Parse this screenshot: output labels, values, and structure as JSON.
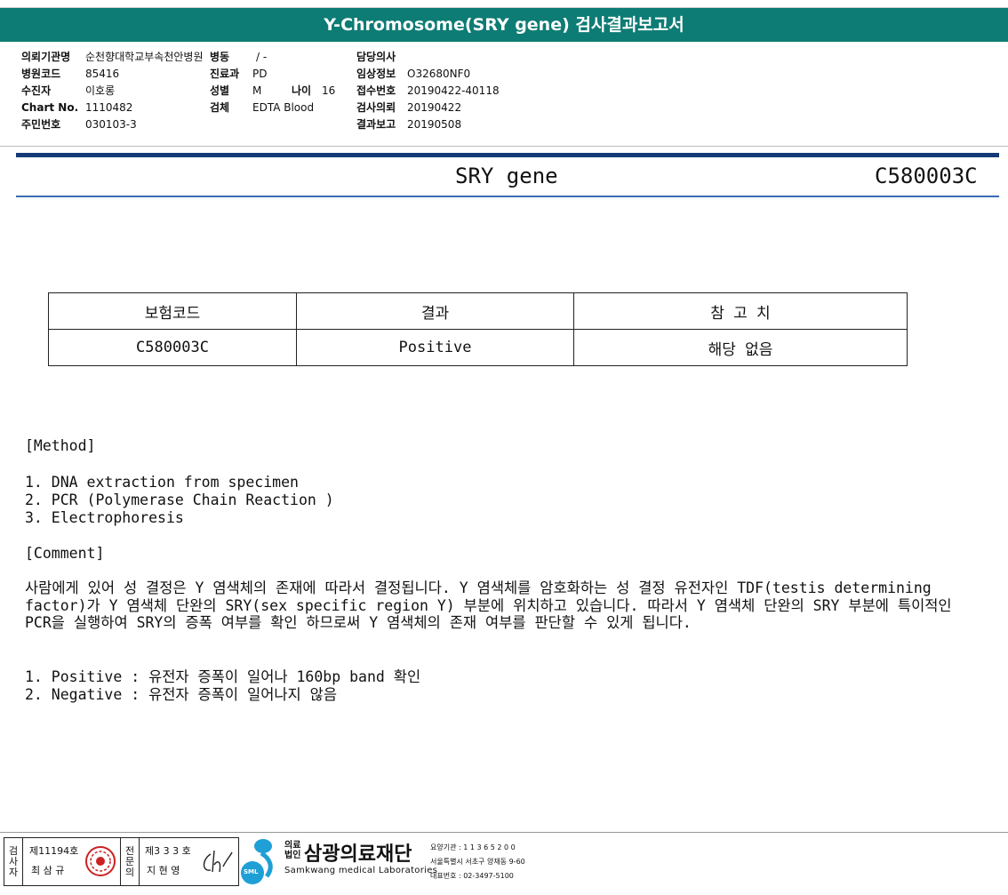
{
  "report": {
    "title": "Y-Chromosome(SRY gene) 검사결과보고서"
  },
  "patient_info": {
    "col1": [
      {
        "label": "의뢰기관명",
        "value": "순천향대학교부속천안병원"
      },
      {
        "label": "병원코드",
        "value": "85416"
      },
      {
        "label": "수진자",
        "value": "이호롱"
      },
      {
        "label": "Chart No.",
        "value": "1110482"
      },
      {
        "label": "주민번호",
        "value": "030103-3"
      }
    ],
    "ward_label": "병동",
    "ward_value": "/ -",
    "dept_label": "진료과",
    "dept_value": "PD",
    "sex_label": "성별",
    "sex_value": "M",
    "age_label": "나이",
    "age_value": "16",
    "specimen_label": "검체",
    "specimen_value": "EDTA Blood",
    "col3": [
      {
        "label": "담당의사",
        "value": ""
      },
      {
        "label": "임상정보",
        "value": "O32680NF0"
      },
      {
        "label": "접수번호",
        "value": "20190422-40118"
      },
      {
        "label": "검사의뢰",
        "value": "20190422"
      },
      {
        "label": "결과보고",
        "value": "20190508"
      }
    ]
  },
  "test": {
    "name": "SRY gene",
    "code": "C580003C"
  },
  "result_table": {
    "headers": [
      "보험코드",
      "결과",
      "참 고 치"
    ],
    "row": [
      "C580003C",
      "Positive",
      "해당 없음"
    ]
  },
  "method": {
    "heading": "[Method]",
    "items": [
      "1. DNA extraction from specimen",
      "2. PCR (Polymerase Chain Reaction )",
      "3. Electrophoresis"
    ]
  },
  "comment": {
    "heading": "[Comment]",
    "paragraph": "사람에게 있어 성 결정은 Y 염색체의 존재에 따라서 결정됩니다. Y 염색체를 암호화하는 성 결정 유전자인 TDF(testis determining factor)가 Y 염색체 단완의 SRY(sex specific region Y) 부분에 위치하고 있습니다. 따라서 Y 염색체 단완의 SRY 부분에 특이적인 PCR을 실행하여 SRY의 증폭 여부를 확인 하므로써 Y 염색체의 존재 여부를 판단할 수 있게 됩니다.",
    "items": [
      "1. Positive : 유전자 증폭이 일어나 160bp band 확인",
      "2. Negative : 유전자 증폭이 일어나지 않음"
    ]
  },
  "footer": {
    "examiner_label": "검사자",
    "examiner_no": "제11194호",
    "examiner_name": "최 삼 규",
    "specialist_label": "전문의",
    "specialist_no": "제3 3 3 호",
    "specialist_name": "지 현 영",
    "org_legal": "의료\n법인",
    "org_name": "삼광의료재단",
    "org_eng": "Samkwang medical Laboratories",
    "logo_text": "SML",
    "care_code": "요양기관 : 1 1 3 6 5 2 0 0",
    "address": "서울특별시 서초구 양재동 9-60",
    "phone": "대표번호 : 02-3497-5100",
    "colors": {
      "title_bar": "#0d7c74",
      "rule": "#143a78",
      "logo": "#1f9fd6",
      "seal": "#cc2222"
    }
  }
}
